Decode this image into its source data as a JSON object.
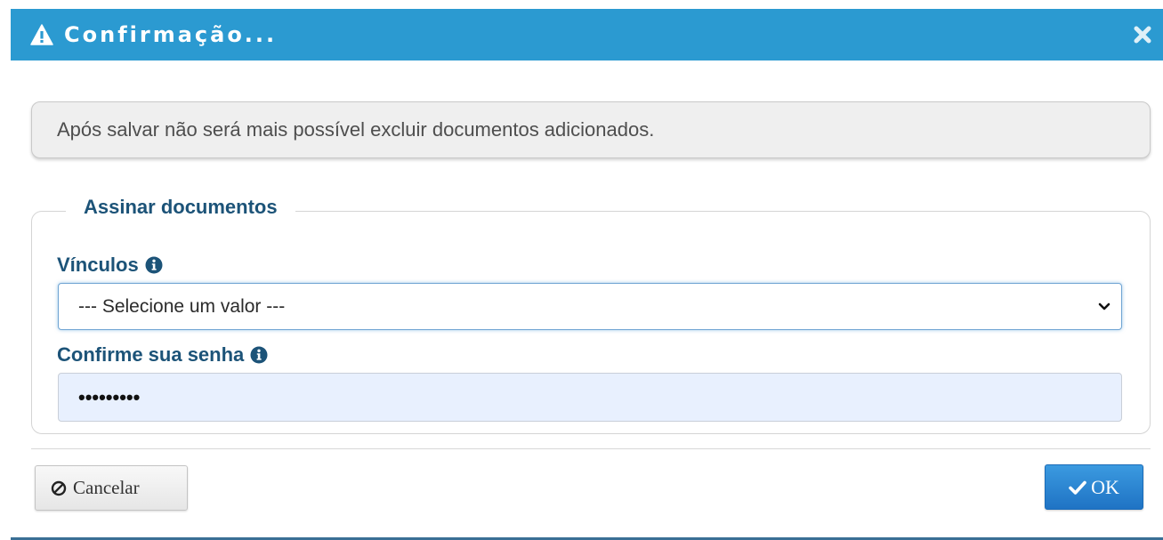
{
  "dialog": {
    "title": "Confirmação...",
    "title_icon": "warning-triangle-icon",
    "close_icon": "close-icon"
  },
  "alert": {
    "message": "Após salvar não será mais possível excluir documentos adicionados."
  },
  "sign_section": {
    "legend": "Assinar documentos",
    "vinculos": {
      "label": "Vínculos",
      "icon": "info-icon",
      "selected_value": "--- Selecione um valor ---"
    },
    "password": {
      "label": "Confirme sua senha",
      "icon": "info-icon",
      "value": "•••••••••"
    }
  },
  "footer": {
    "cancel_label": "Cancelar",
    "cancel_icon": "ban-icon",
    "ok_label": "OK",
    "ok_icon": "check-icon"
  },
  "colors": {
    "header": "#2b9ad1",
    "label_text": "#1c5378",
    "ok_button": "#2783cf",
    "password_bg": "#e8f0fe"
  }
}
